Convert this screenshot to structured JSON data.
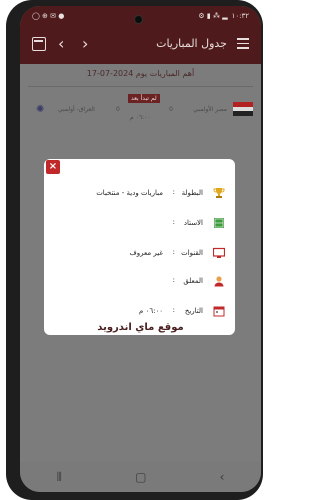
{
  "statusbar": {
    "left_indicators": "◯ ⊕ ✉ ●",
    "right_indicators": "⚙ ▮ ⁂ ▂",
    "time": "١٠:٣٢"
  },
  "appbar": {
    "title": "جدول المباريات"
  },
  "content": {
    "date_text": "أهم المباريات يوم 2024-07-17",
    "match": {
      "home_team": "مصر الأولمبي",
      "away_team": "العراق- أولمبي",
      "home_score": "0",
      "away_score": "0",
      "status_badge": "لم تبدأ بعد",
      "kickoff_time": "٠٦:٠٠ م"
    }
  },
  "dialog": {
    "rows": [
      {
        "label": "البطولة",
        "sep": ":",
        "value": "مباريات ودية - منتخبات",
        "icon": "trophy-icon"
      },
      {
        "label": "الاستاد",
        "sep": ":",
        "value": "",
        "icon": "stadium-icon"
      },
      {
        "label": "القنوات",
        "sep": ":",
        "value": "غير معروف",
        "icon": "tv-icon"
      },
      {
        "label": "المعلق",
        "sep": ":",
        "value": "",
        "icon": "commentator-icon"
      },
      {
        "label": "التاريخ",
        "sep": ":",
        "value": "٠٦:٠٠ م",
        "icon": "calendar-icon"
      }
    ]
  },
  "footer": {
    "site_name": "موقع ماي اندرويد"
  },
  "colors": {
    "brand": "#4e1a1b",
    "close_red": "#c0282a",
    "badge": "#6a2222"
  }
}
